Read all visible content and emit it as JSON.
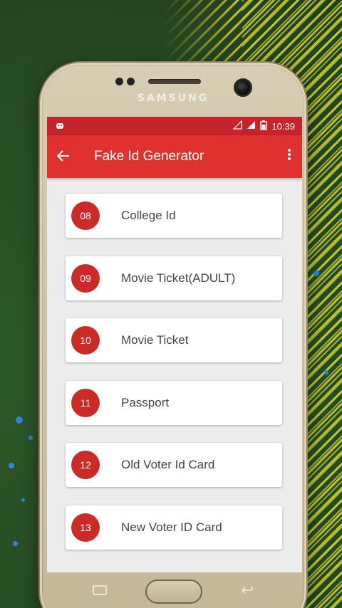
{
  "device": {
    "brand": "SAMSUNG"
  },
  "statusbar": {
    "time": "10:39",
    "left_icon": "android-icon",
    "right_icons": [
      "wifi-icon",
      "signal-icon",
      "battery-icon"
    ]
  },
  "appbar": {
    "back_icon": "arrow-left-icon",
    "title": "Fake Id Generator",
    "more_icon": "more-vert-icon"
  },
  "items": [
    {
      "number": "08",
      "label": "College Id"
    },
    {
      "number": "09",
      "label": "Movie Ticket(ADULT)"
    },
    {
      "number": "10",
      "label": "Movie Ticket"
    },
    {
      "number": "11",
      "label": "Passport"
    },
    {
      "number": "12",
      "label": "Old Voter Id Card"
    },
    {
      "number": "13",
      "label": "New Voter ID Card"
    }
  ],
  "colors": {
    "statusbar": "#c4242a",
    "appbar": "#e0312f",
    "badge": "#cc2a26",
    "background_green": "#2a5226",
    "stripe_yellow": "#decd28"
  }
}
